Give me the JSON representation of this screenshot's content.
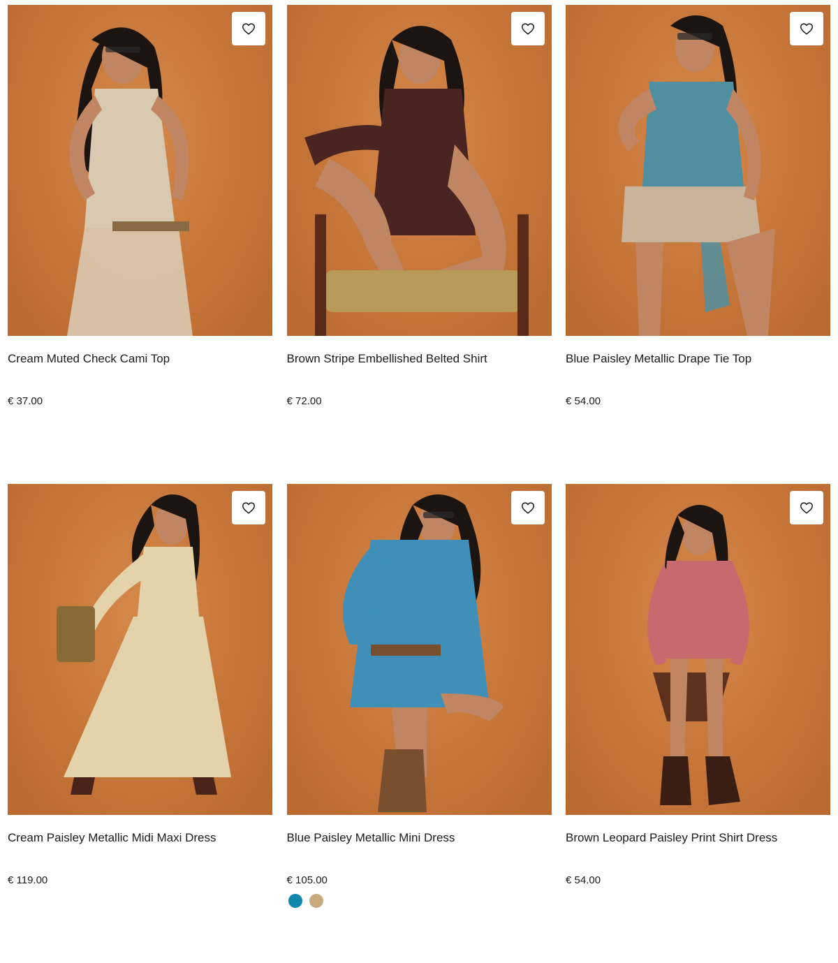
{
  "products": [
    {
      "name": "Cream Muted Check Cami Top",
      "price": "€ 37.00",
      "image": "model-in-cream-check-cami-top",
      "palette": {
        "garment": "#d9c9b0",
        "accent": "#8a6a43",
        "hair": "#1c1410",
        "skin": "#c08562"
      }
    },
    {
      "name": "Brown Stripe Embellished Belted Shirt",
      "price": "€ 72.00",
      "image": "model-in-brown-stripe-shirt-on-chair",
      "palette": {
        "garment": "#4a2420",
        "accent": "#b89a58",
        "hair": "#1c1410",
        "skin": "#c08562"
      }
    },
    {
      "name": "Blue Paisley Metallic Drape Tie Top",
      "price": "€ 54.00",
      "image": "model-in-blue-paisley-drape-top",
      "palette": {
        "garment": "#4f8fa0",
        "accent": "#c9b39a",
        "hair": "#1c1410",
        "skin": "#c08562"
      }
    },
    {
      "name": "Cream Paisley Metallic Midi Maxi Dress",
      "price": "€ 119.00",
      "image": "model-in-cream-paisley-maxi-dress",
      "palette": {
        "garment": "#e3d2aa",
        "accent": "#8b6a3a",
        "hair": "#1c1410",
        "skin": "#c08562"
      }
    },
    {
      "name": "Blue Paisley Metallic Mini Dress",
      "price": "€ 105.00",
      "image": "model-in-blue-paisley-mini-dress",
      "palette": {
        "garment": "#3f8fb8",
        "accent": "#7a4f2e",
        "hair": "#1c1410",
        "skin": "#c08562"
      },
      "swatches": [
        {
          "color": "#1187ad",
          "label": "blue"
        },
        {
          "color": "#c8a87d",
          "label": "beige"
        }
      ]
    },
    {
      "name": "Brown Leopard Paisley Print Shirt Dress",
      "price": "€ 54.00",
      "image": "model-in-pink-paisley-shirt-dress",
      "palette": {
        "garment": "#c66a6f",
        "accent": "#4a2418",
        "hair": "#1c1410",
        "skin": "#c08562"
      }
    }
  ],
  "icons": {
    "wishlist": "heart-icon"
  }
}
